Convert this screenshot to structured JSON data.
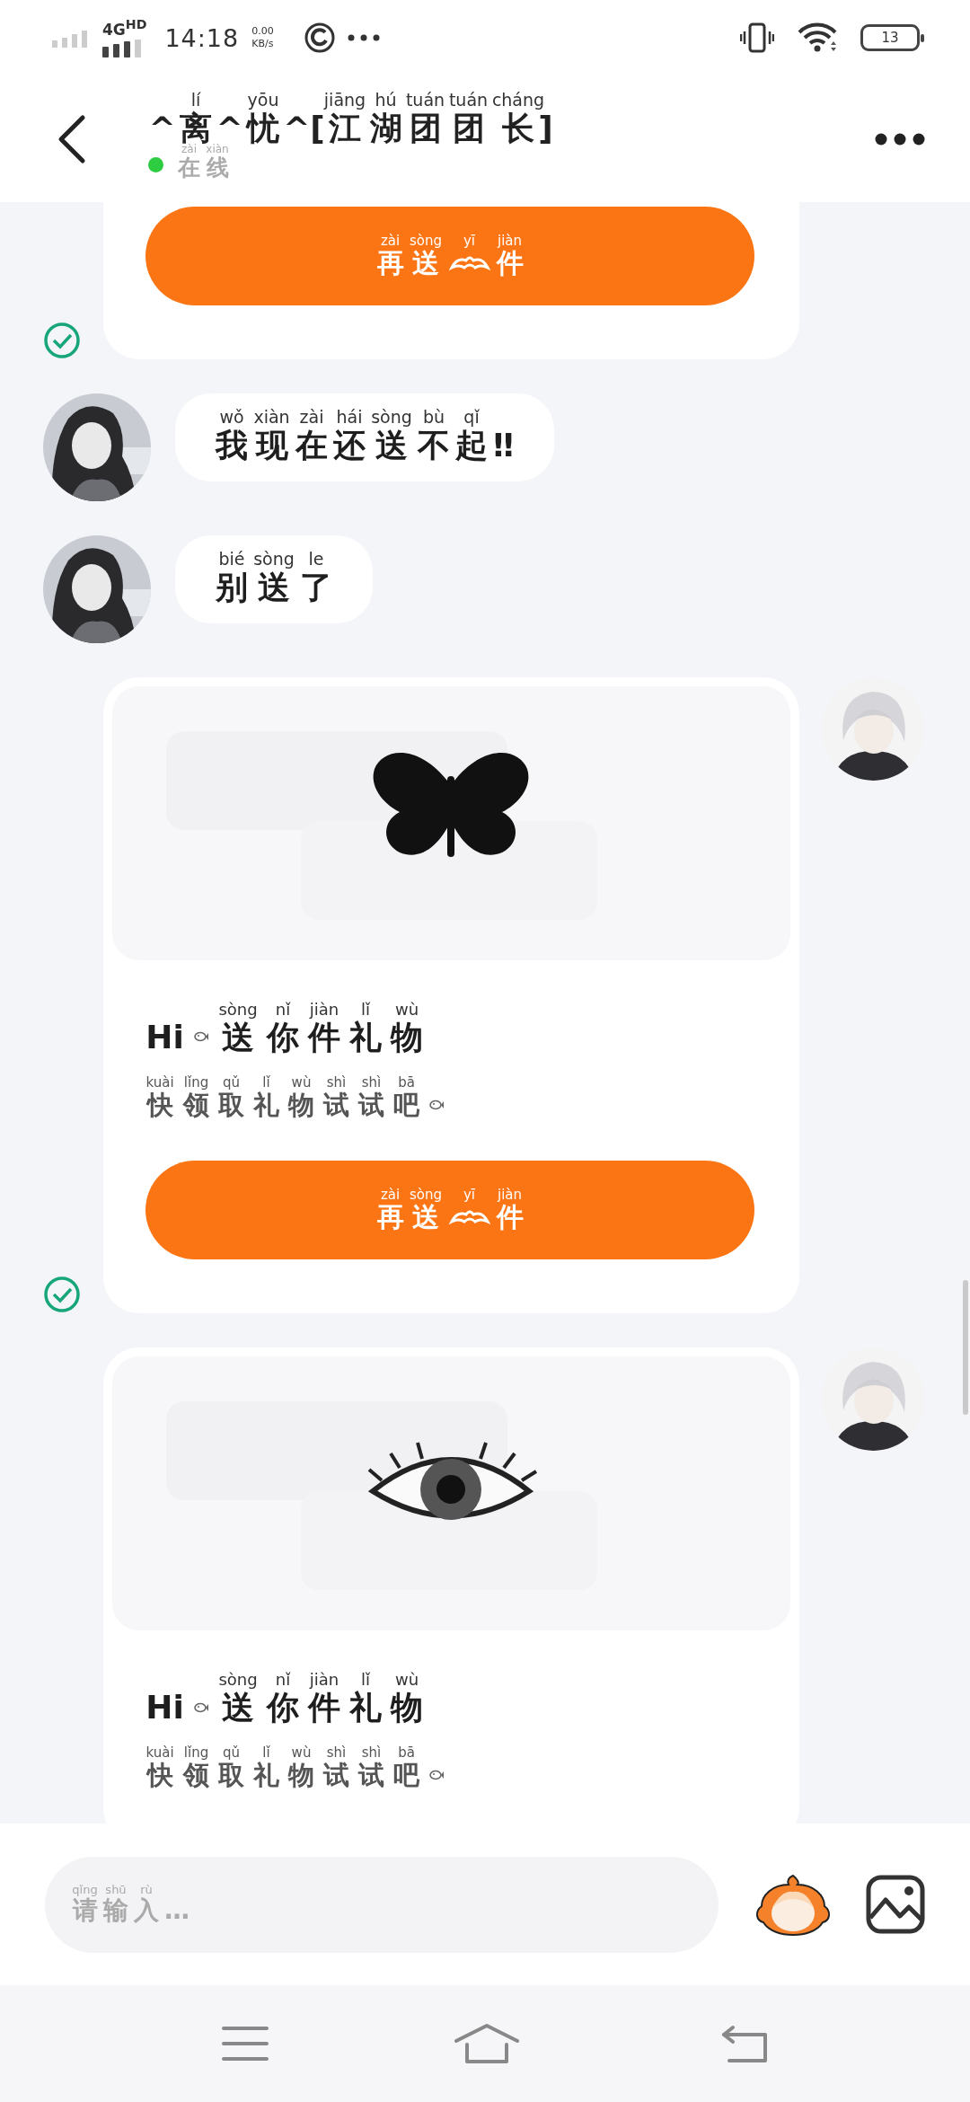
{
  "status_bar": {
    "network": "4G",
    "network_badge": "HD",
    "time": "14:18",
    "speed": "0.00",
    "speed_unit": "KB/s",
    "battery": "13"
  },
  "header": {
    "title": "^离^忧^[江湖团团长]",
    "title_pinyin": "lí yōu jiāng hú tuán tuán cháng",
    "status": "在线",
    "status_pinyin": "zài xiàn",
    "online": true
  },
  "messages": [
    {
      "kind": "gift",
      "delivered": true,
      "button": [
        {
          "kind": "text",
          "text": "再送",
          "pinyin": "zài sòng"
        },
        {
          "kind": "sticker",
          "pinyin": "yī"
        },
        {
          "kind": "text",
          "text": "件",
          "pinyin": "jiàn"
        }
      ]
    },
    {
      "kind": "text",
      "parts": [
        {
          "kind": "text",
          "text": "我现在还送不起‼",
          "pinyin": "wǒ xiàn zài hái sòng bù qǐ"
        }
      ]
    },
    {
      "kind": "text",
      "parts": [
        {
          "kind": "text",
          "text": "别送了",
          "pinyin": "bié sòng le"
        }
      ]
    },
    {
      "kind": "gift",
      "delivered": true,
      "image": {
        "kind": "picture"
      },
      "lines": [
        {
          "kind": "title",
          "parts": [
            {
              "kind": "text",
              "text": "Hi"
            },
            {
              "kind": "sticker"
            },
            {
              "kind": "text",
              "text": "送你件礼物",
              "pinyin": "sòng nǐ jiàn lǐ wù"
            }
          ]
        },
        {
          "kind": "subtitle",
          "parts": [
            {
              "kind": "text",
              "text": "快领取礼物试试吧",
              "pinyin": "kuài lǐng qǔ lǐ wù shì shì bā"
            },
            {
              "kind": "sticker"
            }
          ]
        }
      ],
      "button": [
        {
          "kind": "text",
          "text": "再送",
          "pinyin": "zài sòng"
        },
        {
          "kind": "sticker",
          "pinyin": "yī"
        },
        {
          "kind": "text",
          "text": "件",
          "pinyin": "jiàn"
        }
      ]
    },
    {
      "kind": "gift",
      "image": {
        "kind": "picture"
      },
      "lines": [
        {
          "kind": "title",
          "parts": [
            {
              "kind": "text",
              "text": "Hi"
            },
            {
              "kind": "sticker"
            },
            {
              "kind": "text",
              "text": "送你件礼物",
              "pinyin": "sòng nǐ jiàn lǐ wù"
            }
          ]
        },
        {
          "kind": "subtitle",
          "parts": [
            {
              "kind": "text",
              "text": "快领取礼物试试吧",
              "pinyin": "kuài lǐng qǔ lǐ wù shì shì bā"
            },
            {
              "kind": "sticker"
            }
          ]
        }
      ]
    }
  ],
  "input": {
    "placeholder": "请输入…",
    "placeholder_pinyin": "qǐng shū rù"
  }
}
